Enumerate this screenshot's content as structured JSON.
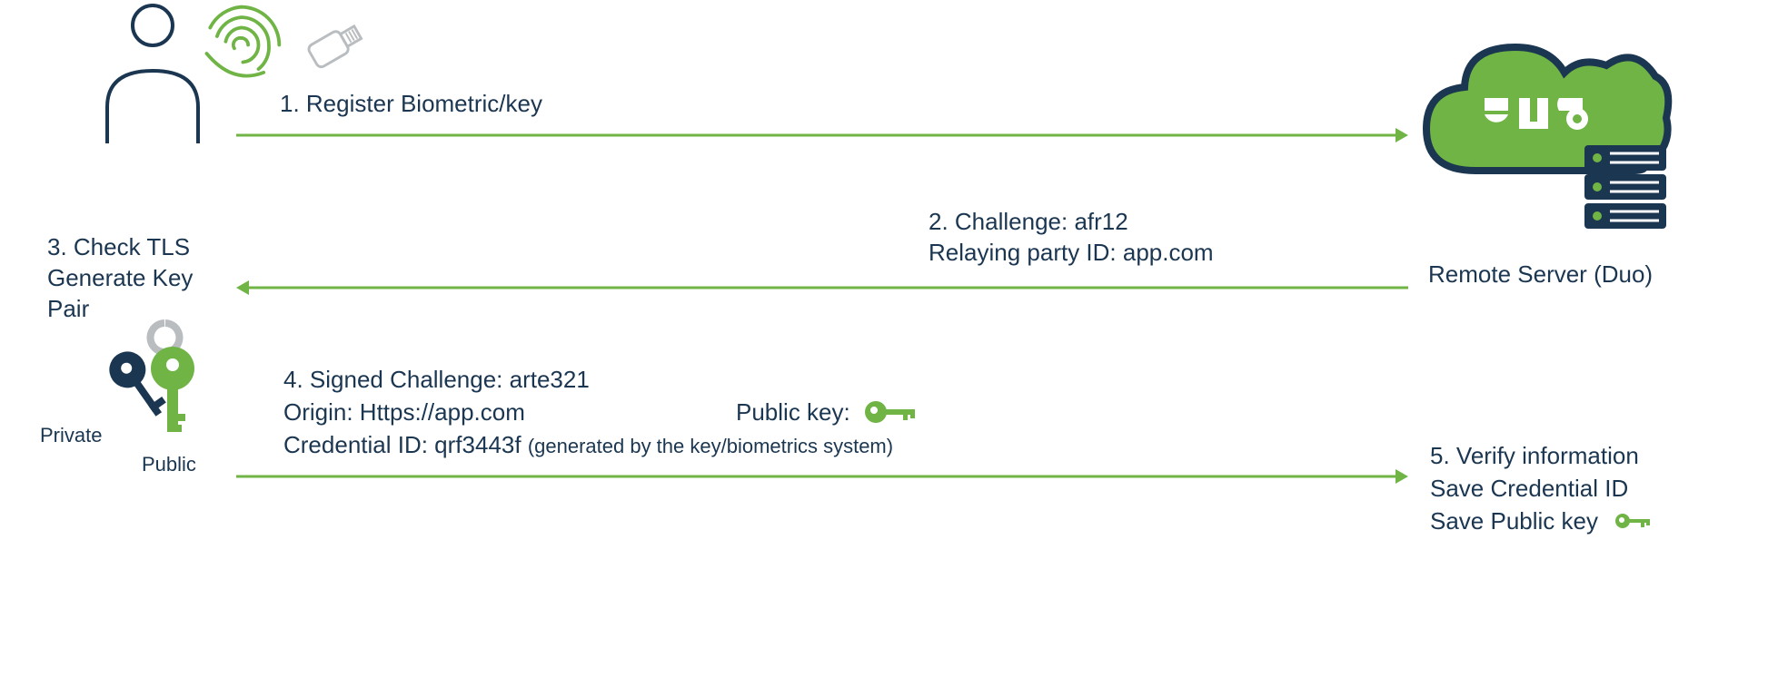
{
  "step1_label": "1. Register Biometric/key",
  "step2_line1": "2. Challenge: afr12",
  "step2_line2": "Relaying party ID: app.com",
  "step3_line1": "3. Check TLS",
  "step3_line2": "Generate Key",
  "step3_line3": "Pair",
  "step4_line1": "4. Signed Challenge: arte321",
  "step4_line2": "Origin: Https://app.com",
  "step4_line3a": "Credential ID: qrf3443f ",
  "step4_line3b": "(generated by the key/biometrics system)",
  "step4_pubkey": "Public key:",
  "step5_line1": "5. Verify information",
  "step5_line2": "Save Credential ID",
  "step5_line3": "Save Public key",
  "server_label": "Remote Server (Duo)",
  "key_private": "Private",
  "key_public": "Public",
  "colors": {
    "navy": "#1b3651",
    "green": "#6fb445",
    "grey": "#babdc0"
  }
}
